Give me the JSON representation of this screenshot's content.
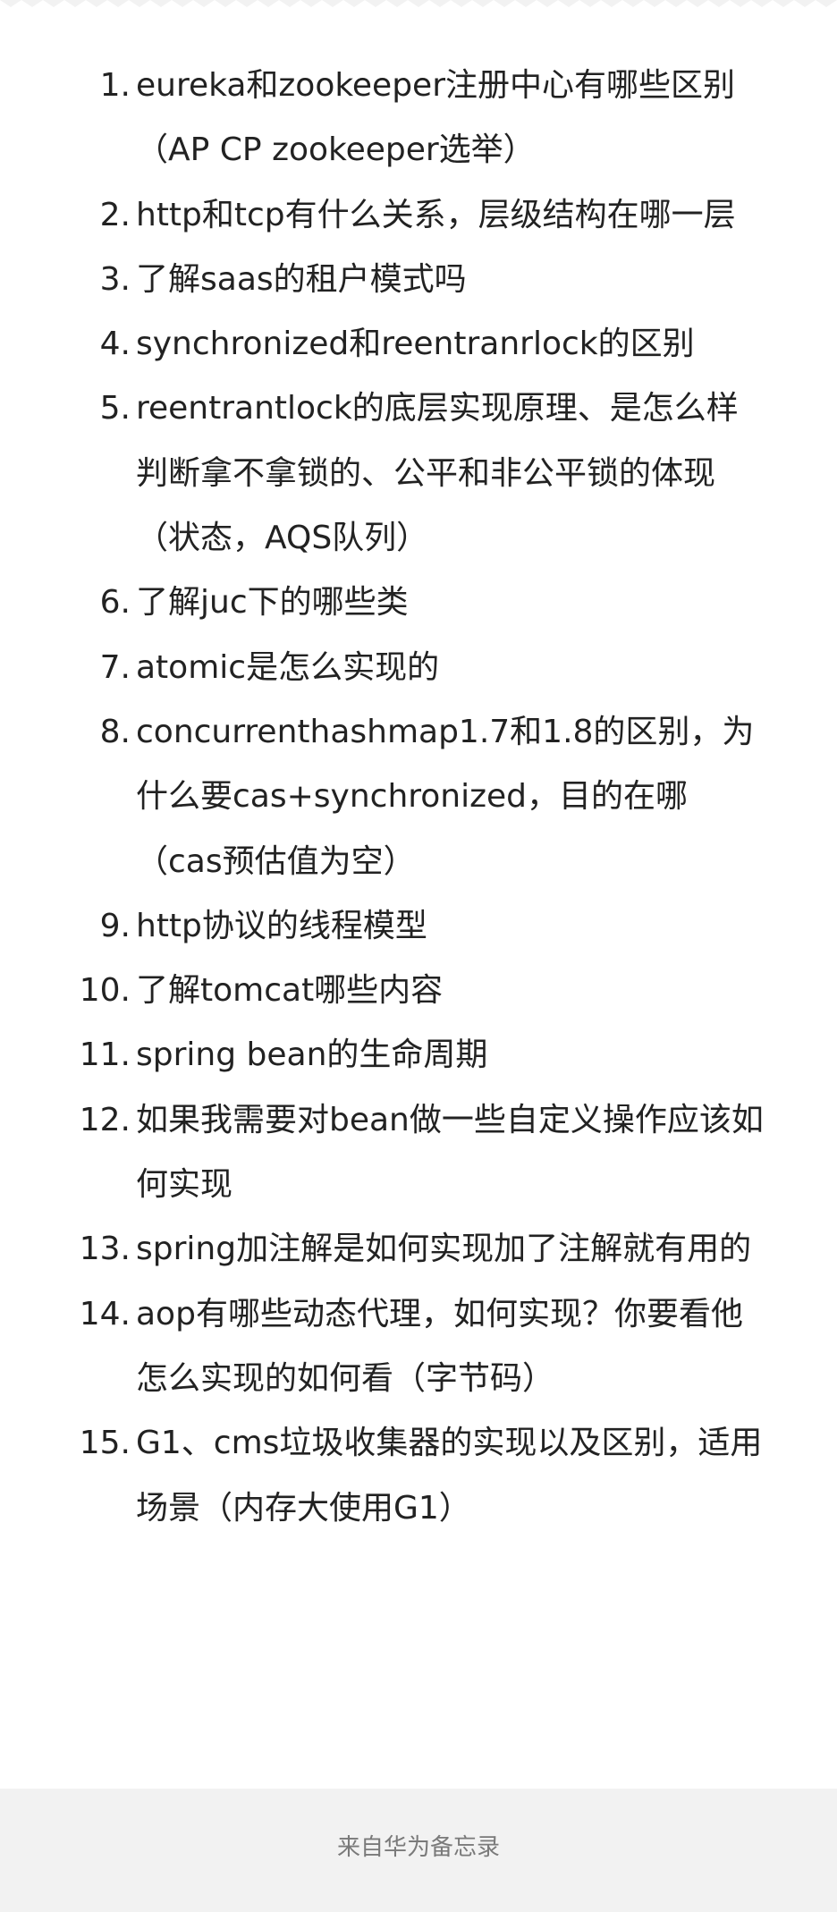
{
  "note": {
    "items": [
      {
        "num": "1.",
        "text": "eureka和zookeeper注册中心有哪些区别（AP CP  zookeeper选举）"
      },
      {
        "num": "2.",
        "text": "http和tcp有什么关系，层级结构在哪一层"
      },
      {
        "num": "3.",
        "text": "了解saas的租户模式吗"
      },
      {
        "num": "4.",
        "text": "synchronized和reentranrlock的区别"
      },
      {
        "num": "5.",
        "text": "reentrantlock的底层实现原理、是怎么样判断拿不拿锁的、公平和非公平锁的体现（状态，AQS队列）"
      },
      {
        "num": "6.",
        "text": "了解juc下的哪些类"
      },
      {
        "num": "7.",
        "text": "atomic是怎么实现的"
      },
      {
        "num": "8.",
        "text": "concurrenthashmap1.7和1.8的区别，为什么要cas+synchronized，目的在哪（cas预估值为空）"
      },
      {
        "num": "9.",
        "text": "http协议的线程模型"
      },
      {
        "num": "10.",
        "text": "了解tomcat哪些内容"
      },
      {
        "num": "11.",
        "text": "spring bean的生命周期"
      },
      {
        "num": "12.",
        "text": "如果我需要对bean做一些自定义操作应该如何实现"
      },
      {
        "num": "13.",
        "text": "spring加注解是如何实现加了注解就有用的"
      },
      {
        "num": "14.",
        "text": "aop有哪些动态代理，如何实现？你要看他怎么实现的如何看（字节码）"
      },
      {
        "num": "15.",
        "text": "G1、cms垃圾收集器的实现以及区别，适用场景（内存大使用G1）"
      }
    ]
  },
  "footer": {
    "source_label": "来自华为备忘录"
  },
  "colors": {
    "background": "#f2f2f2",
    "card": "#ffffff",
    "text": "#222222",
    "footer_text": "#7a7a7a"
  }
}
